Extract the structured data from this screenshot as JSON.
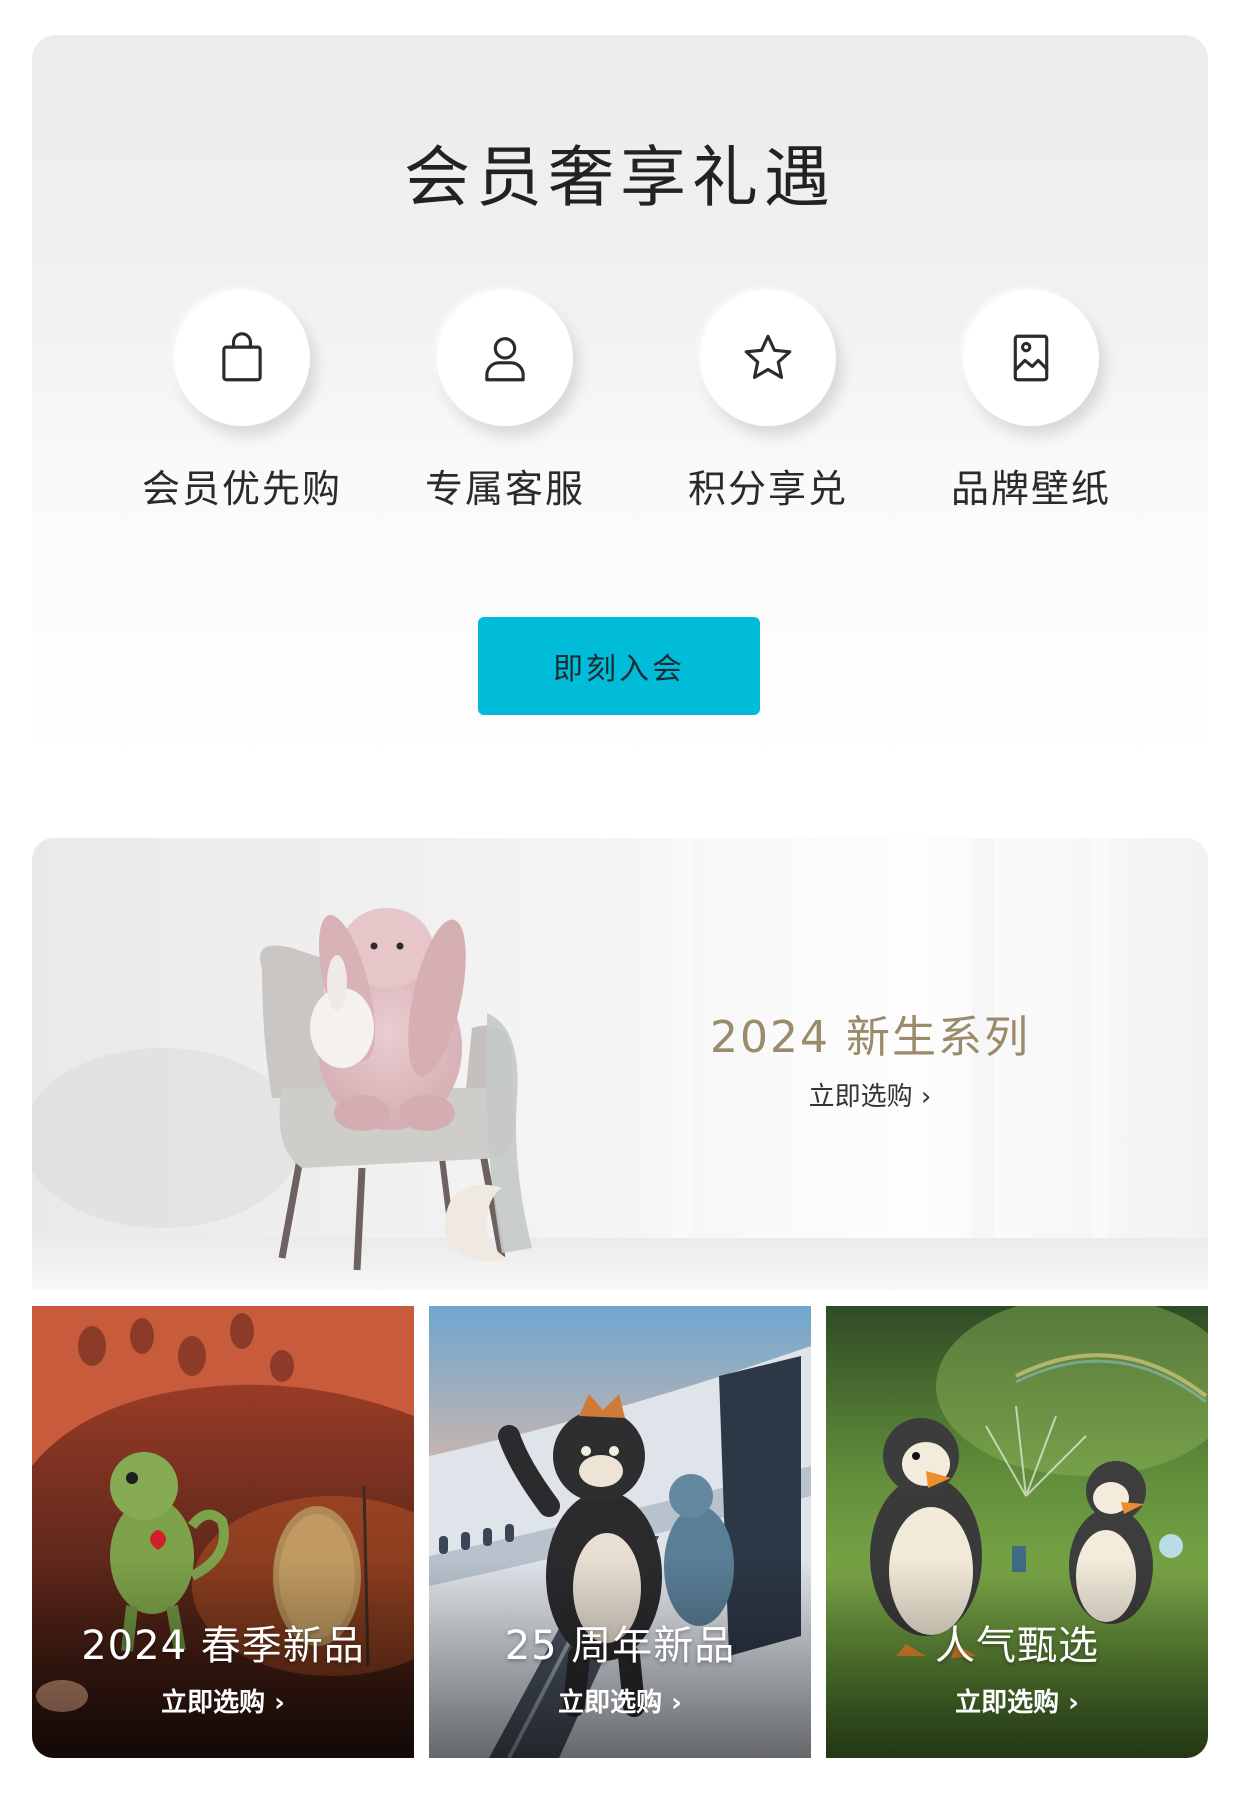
{
  "membership": {
    "title": "会员奢享礼遇",
    "benefits": [
      {
        "icon": "shopping-bag-icon",
        "label": "会员优先购"
      },
      {
        "icon": "user-icon",
        "label": "专属客服"
      },
      {
        "icon": "star-icon",
        "label": "积分享兑"
      },
      {
        "icon": "image-icon",
        "label": "品牌壁纸"
      }
    ],
    "join_label": "即刻入会",
    "accent_color": "#00bcd9"
  },
  "hero": {
    "title": "2024 新生系列",
    "cta": "立即选购 ›",
    "title_color": "#9b8a6b"
  },
  "tiles": [
    {
      "title": "2024 春季新品",
      "cta": "立即选购 ›"
    },
    {
      "title": "25 周年新品",
      "cta": "立即选购 ›"
    },
    {
      "title": "人气甄选",
      "cta": "立即选购 ›"
    }
  ]
}
